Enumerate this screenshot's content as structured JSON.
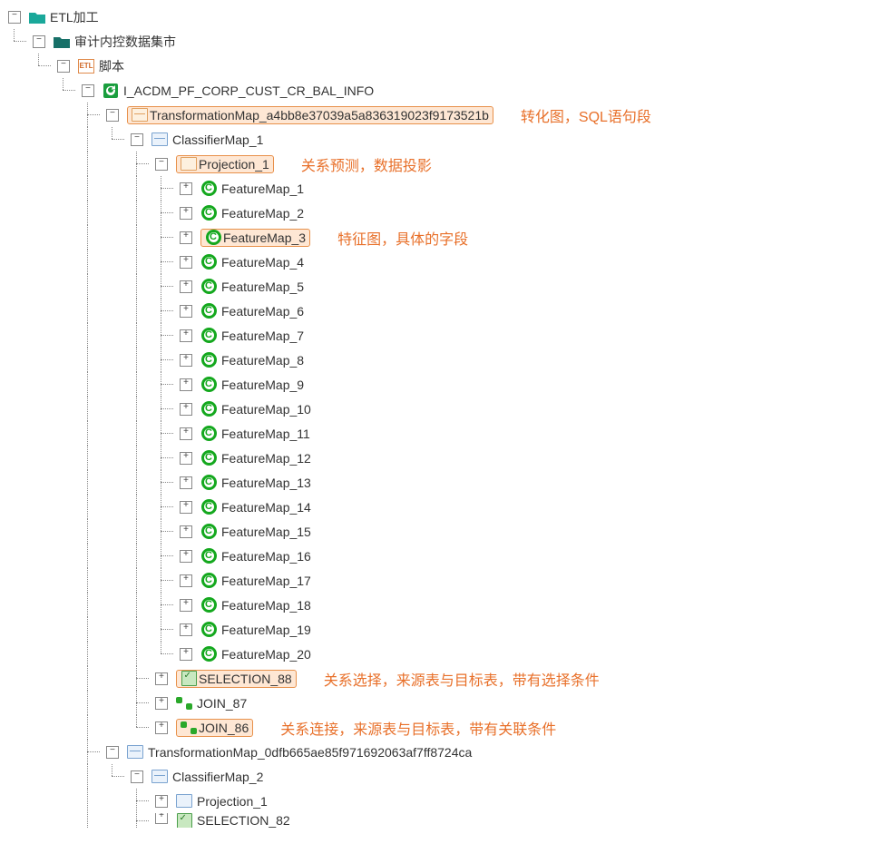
{
  "tree": {
    "root": "ETL加工",
    "level1": "审计内控数据集市",
    "level2": "脚本",
    "level3": "I_ACDM_PF_CORP_CUST_CR_BAL_INFO",
    "tmap1": "TransformationMap_a4bb8e37039a5a836319023f9173521b",
    "cmap1": "ClassifierMap_1",
    "proj1": "Projection_1",
    "features": [
      "FeatureMap_1",
      "FeatureMap_2",
      "FeatureMap_3",
      "FeatureMap_4",
      "FeatureMap_5",
      "FeatureMap_6",
      "FeatureMap_7",
      "FeatureMap_8",
      "FeatureMap_9",
      "FeatureMap_10",
      "FeatureMap_11",
      "FeatureMap_12",
      "FeatureMap_13",
      "FeatureMap_14",
      "FeatureMap_15",
      "FeatureMap_16",
      "FeatureMap_17",
      "FeatureMap_18",
      "FeatureMap_19",
      "FeatureMap_20"
    ],
    "selection88": "SELECTION_88",
    "join87": "JOIN_87",
    "join86": "JOIN_86",
    "tmap2": "TransformationMap_0dfb665ae85f971692063af7ff8724ca",
    "cmap2": "ClassifierMap_2",
    "proj2": "Projection_1",
    "sel82": "SELECTION_82"
  },
  "annotations": {
    "tmap": "转化图，SQL语句段",
    "proj": "关系预测，数据投影",
    "feat": "特征图，具体的字段",
    "sel": "关系选择，来源表与目标表，带有选择条件",
    "join": "关系连接，来源表与目标表，带有关联条件"
  },
  "glyphs": {
    "plus": "+",
    "minus": "−",
    "c": "C"
  }
}
